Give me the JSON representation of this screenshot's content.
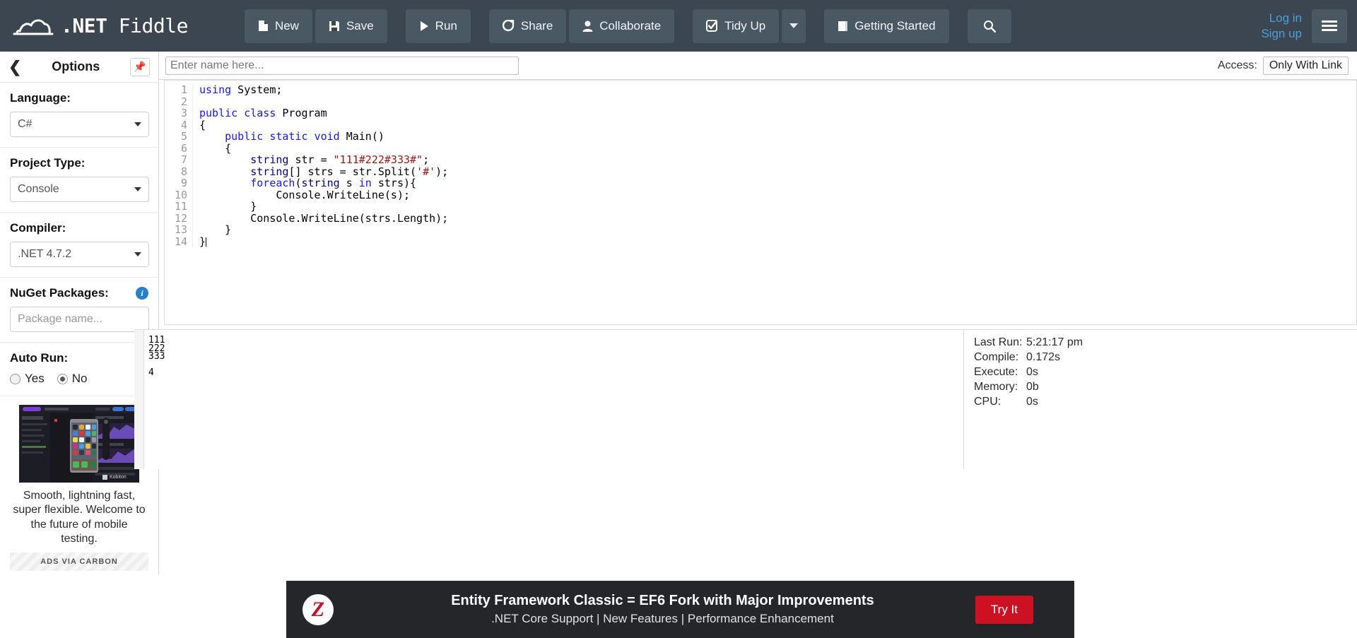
{
  "nav": {
    "brand_net": ".NET",
    "brand_fiddle": " Fiddle",
    "buttons": [
      {
        "label": "New",
        "icon": "file-icon"
      },
      {
        "label": "Save",
        "icon": "save-icon"
      },
      {
        "label": "Run",
        "icon": "play-icon"
      },
      {
        "label": "Share",
        "icon": "share-icon"
      },
      {
        "label": "Collaborate",
        "icon": "user-icon"
      },
      {
        "label": "Tidy Up",
        "icon": "check-square-icon"
      },
      {
        "label": "Getting Started",
        "icon": "book-icon"
      }
    ],
    "search_icon": "search-icon",
    "login": "Log in",
    "signup": "Sign up",
    "menu_icon": "hamburger-icon"
  },
  "sidebar": {
    "title": "Options",
    "back_icon": "chevron-left-icon",
    "pin_icon": "pin-icon",
    "language": {
      "label": "Language:",
      "value": "C#"
    },
    "project_type": {
      "label": "Project Type:",
      "value": "Console"
    },
    "compiler": {
      "label": "Compiler:",
      "value": ".NET 4.7.2"
    },
    "nuget": {
      "label": "NuGet Packages:",
      "placeholder": "Package name...",
      "value": "",
      "info_icon": "info-icon"
    },
    "auto_run": {
      "label": "Auto Run:",
      "yes": "Yes",
      "no": "No",
      "selected": "No"
    },
    "ad": {
      "text": "Smooth, lightning fast, super flexible. Welcome to the future of mobile testing.",
      "brand": "Kobiton",
      "via": "ADS VIA CARBON"
    }
  },
  "namebar": {
    "placeholder": "Enter name here...",
    "value": "",
    "access_label": "Access:",
    "access_value": "Only With Link"
  },
  "editor": {
    "line_numbers": [
      "1",
      "2",
      "3",
      "4",
      "5",
      "6",
      "7",
      "8",
      "9",
      "10",
      "11",
      "12",
      "13",
      "14"
    ],
    "code": "using System;\n\npublic class Program\n{\n    public static void Main()\n    {\n        string str = \"111#222#333#\";\n        string[] strs = str.Split('#');\n        foreach(string s in strs){\n            Console.WriteLine(s);\n        }\n        Console.WriteLine(strs.Length);\n    }\n}"
  },
  "output": {
    "console": "111\n222\n333\n\n4",
    "stats": [
      {
        "key": "Last Run:",
        "value": "5:21:17 pm"
      },
      {
        "key": "Compile:",
        "value": "0.172s"
      },
      {
        "key": "Execute:",
        "value": "0s"
      },
      {
        "key": "Memory:",
        "value": "0b"
      },
      {
        "key": "CPU:",
        "value": "0s"
      }
    ]
  },
  "bottom_ad": {
    "headline": "Entity Framework Classic = EF6 Fork with Major Improvements",
    "subline": ".NET Core Support | New Features | Performance Enhancement",
    "cta": "Try It"
  },
  "colors": {
    "nav_bg": "#3b4650",
    "btn_bg": "#4a5864",
    "link": "#4a9fe0",
    "keyword": "#1515ff",
    "keyword_type": "#00008b",
    "string": "#a31515",
    "ad_red": "#cc1122"
  }
}
